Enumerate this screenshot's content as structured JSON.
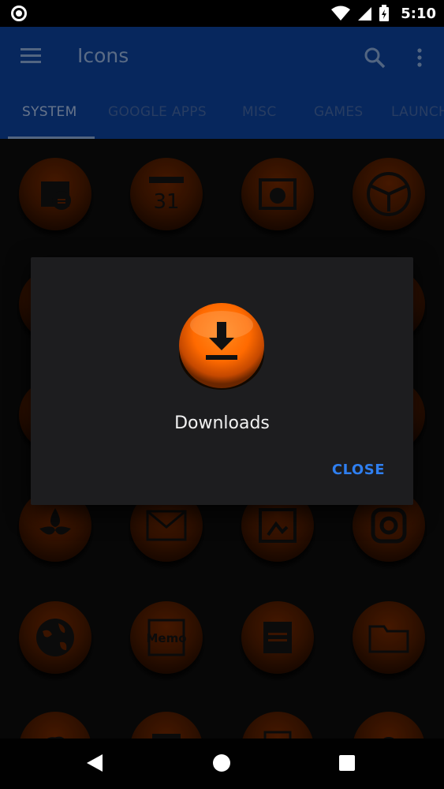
{
  "status_bar": {
    "time": "5:10"
  },
  "app_bar": {
    "title": "Icons",
    "tabs": [
      {
        "label": "SYSTEM",
        "active": true
      },
      {
        "label": "GOOGLE APPS",
        "active": false
      },
      {
        "label": "MISC",
        "active": false
      },
      {
        "label": "GAMES",
        "active": false
      },
      {
        "label": "LAUNCH",
        "active": false
      }
    ]
  },
  "grid": {
    "memo_label": "Memo",
    "calendar_day": "31"
  },
  "dialog": {
    "title": "Downloads",
    "close_label": "CLOSE",
    "icon": "download-icon"
  },
  "colors": {
    "accent_orange": "#ff6a00",
    "app_bar_blue": "#0d47a1",
    "button_blue": "#2f7ff0"
  }
}
